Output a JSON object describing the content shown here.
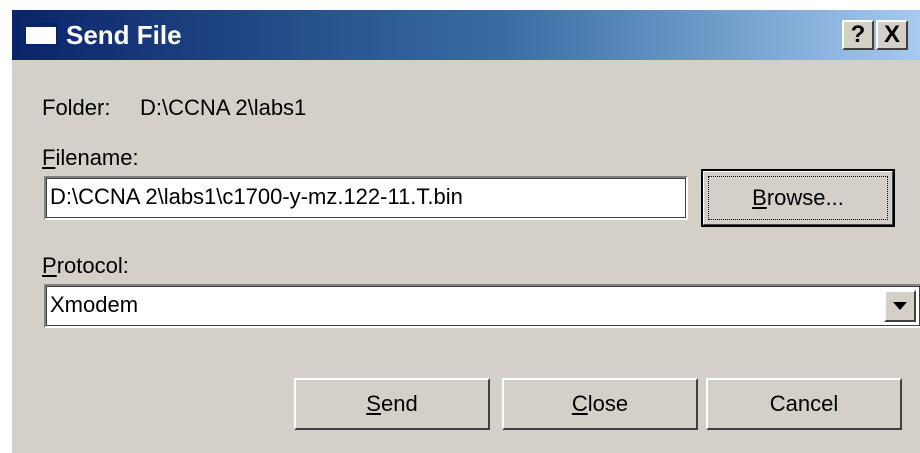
{
  "window": {
    "title": "Send File",
    "help_label": "?",
    "close_label": "X"
  },
  "folder": {
    "label": "Folder:",
    "value": "D:\\CCNA 2\\labs1"
  },
  "filename": {
    "label_first": "F",
    "label_rest": "ilename:",
    "value": "D:\\CCNA 2\\labs1\\c1700-y-mz.122-11.T.bin"
  },
  "browse": {
    "label_first": "B",
    "label_rest": "rowse..."
  },
  "protocol": {
    "label_first": "P",
    "label_rest": "rotocol:",
    "selected": "Xmodem"
  },
  "buttons": {
    "send_first": "S",
    "send_rest": "end",
    "close_first": "C",
    "close_rest": "lose",
    "cancel": "Cancel"
  },
  "colors": {
    "titlebar_start": "#0a246a",
    "titlebar_end": "#a6caf0",
    "face": "#d4d0c8"
  }
}
